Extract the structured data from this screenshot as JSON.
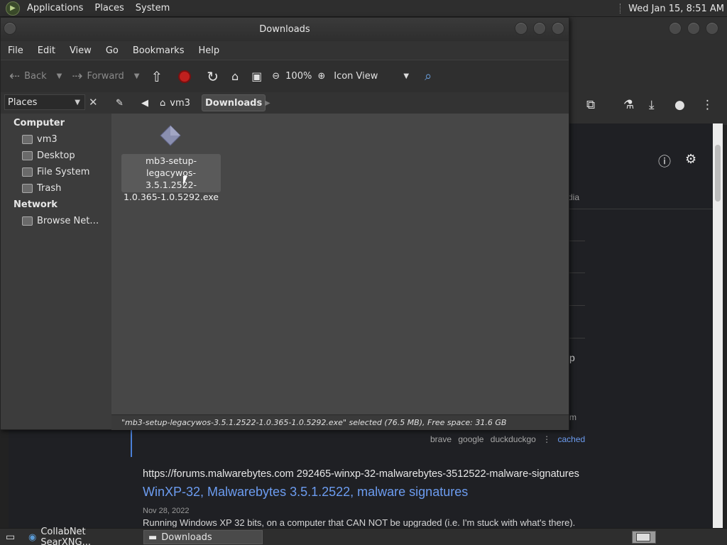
{
  "top_panel": {
    "menus": [
      "Applications",
      "Places",
      "System"
    ],
    "clock": "Wed Jan 15,  8:51 AM"
  },
  "browser": {
    "side_fragments": [
      "dia",
      "p",
      "m"
    ],
    "result_engines": [
      "brave",
      "google",
      "duckduckgo"
    ],
    "cached_label": "cached",
    "result": {
      "url": "https://forums.malwarebytes.com   292465-winxp-32-malwarebytes-3512522-malware-signatures",
      "title": "WinXP-32, Malwarebytes 3.5.1.2522, malware signatures",
      "date": "Nov 28, 2022",
      "snippet": "Running Windows XP 32 bits, on a computer that CAN NOT be upgraded (i.e. I'm stuck with what's there)."
    }
  },
  "file_manager": {
    "title": "Downloads",
    "menubar": [
      "File",
      "Edit",
      "View",
      "Go",
      "Bookmarks",
      "Help"
    ],
    "toolbar": {
      "back": "Back",
      "forward": "Forward",
      "zoom": "100%",
      "view_mode": "Icon View"
    },
    "sidebar_combo": "Places",
    "breadcrumbs": [
      "vm3",
      "Downloads"
    ],
    "sidebar": {
      "computer_head": "Computer",
      "computer_items": [
        "vm3",
        "Desktop",
        "File System",
        "Trash"
      ],
      "network_head": "Network",
      "network_items": [
        "Browse Net…"
      ]
    },
    "file": {
      "name_line1": "mb3-setup-",
      "name_line2": "legacywos-3.5.1.2522-",
      "name_line3": "1.0.365-1.0.5292.exe"
    },
    "status": "\"mb3-setup-legacywos-3.5.1.2522-1.0.365-1.0.5292.exe\" selected (76.5 MB), Free space: 31.6 GB"
  },
  "taskbar": {
    "tasks": [
      "CollabNet SearXNG...",
      "Downloads"
    ]
  }
}
